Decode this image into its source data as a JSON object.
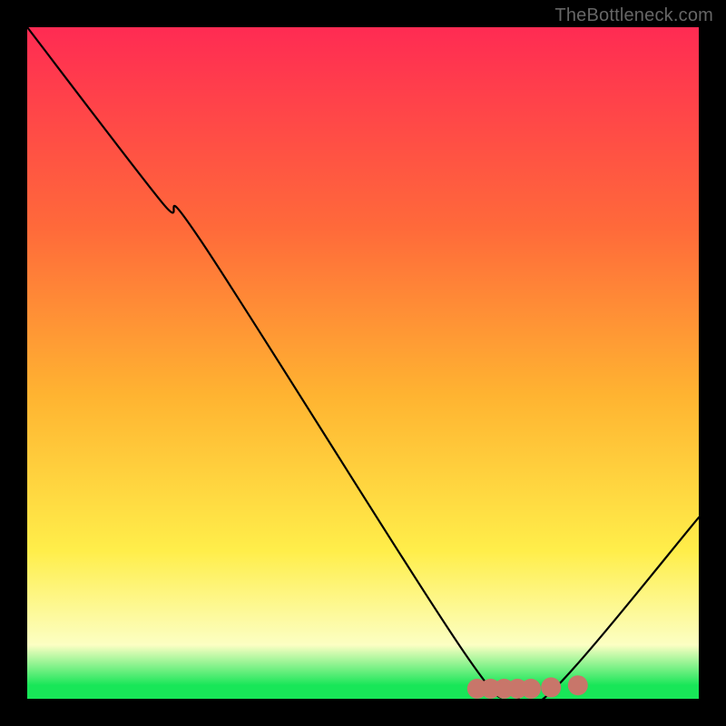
{
  "watermark": "TheBottleneck.com",
  "colors": {
    "gradient_top": "#ff2b53",
    "gradient_mid1": "#ff6a3a",
    "gradient_mid2": "#ffb431",
    "gradient_yellow": "#ffee4a",
    "gradient_pale": "#fcffc3",
    "gradient_green": "#18e658",
    "curve": "#000000",
    "dot": "#c8766a"
  },
  "chart_data": {
    "type": "line",
    "title": "",
    "xlabel": "",
    "ylabel": "",
    "xlim": [
      0,
      100
    ],
    "ylim": [
      0,
      100
    ],
    "series": [
      {
        "name": "bottleneck-curve",
        "x": [
          0,
          20,
          26,
          65,
          72,
          78,
          100
        ],
        "values": [
          100,
          74,
          68,
          7,
          1,
          1,
          27
        ]
      }
    ],
    "points": [
      {
        "name": "dot-cluster-1",
        "x": 67,
        "y": 1.5,
        "r": 1.2
      },
      {
        "name": "dot-cluster-2",
        "x": 69,
        "y": 1.5,
        "r": 1.2
      },
      {
        "name": "dot-cluster-3",
        "x": 71,
        "y": 1.5,
        "r": 1.2
      },
      {
        "name": "dot-cluster-4",
        "x": 73,
        "y": 1.5,
        "r": 1.2
      },
      {
        "name": "dot-cluster-5",
        "x": 75,
        "y": 1.5,
        "r": 1.2
      },
      {
        "name": "dot-cluster-6",
        "x": 78,
        "y": 1.7,
        "r": 1.2
      },
      {
        "name": "dot-outlier",
        "x": 82,
        "y": 2.0,
        "r": 1.2
      }
    ]
  }
}
